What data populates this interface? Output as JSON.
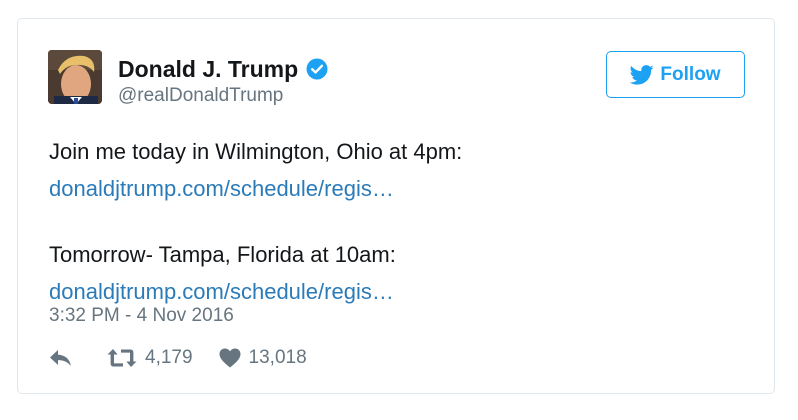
{
  "author": {
    "name": "Donald J. Trump",
    "handle": "@realDonaldTrump",
    "verified": true
  },
  "follow_button": {
    "label": "Follow",
    "icon": "twitter-bird-icon"
  },
  "tweet": {
    "line1": "Join me today in Wilmington, Ohio at 4pm:",
    "link1": "donaldjtrump.com/schedule/regis…",
    "line2": "Tomorrow- Tampa, Florida at 10am:",
    "link2": "donaldjtrump.com/schedule/regis…"
  },
  "timestamp": "3:32 PM - 4 Nov 2016",
  "actions": {
    "reply_icon": "reply-icon",
    "retweet_icon": "retweet-icon",
    "retweet_count": "4,179",
    "like_icon": "heart-icon",
    "like_count": "13,018"
  },
  "colors": {
    "brand_blue": "#1da1f2",
    "link": "#2b7bb9",
    "muted": "#66757f",
    "border": "#e1e8ed"
  }
}
